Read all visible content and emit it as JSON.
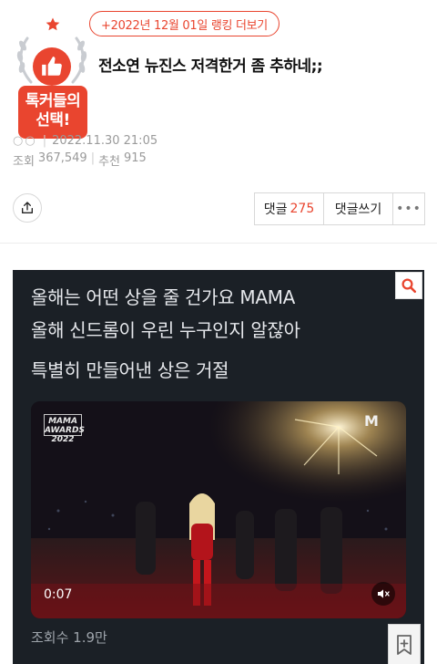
{
  "header": {
    "badge_text": "톡커들의 선택!",
    "badge_icon": "thumbs-up-icon",
    "ranking_link": "+2022년 12월 01일 랭킹 더보기",
    "title": "전소연 뉴진스 저격한거 좀 추하네;;"
  },
  "meta": {
    "author_dots": "○○",
    "datetime": "2022.11.30 21:05",
    "views_label": "조회",
    "views_value": "367,549",
    "likes_label": "추천",
    "likes_value": "915"
  },
  "actions": {
    "share_icon": "share-icon",
    "comment_label": "댓글",
    "comment_count": "275",
    "write_label": "댓글쓰기",
    "more_label": "•••"
  },
  "content": {
    "lyric_line_1": "올해는 어떤 상을 줄 건가요 MAMA",
    "lyric_line_2": "올해 신드롬이 우린 누구인지 알잖아",
    "lyric_line_3": "특별히 만들어낸 상은 거절",
    "video": {
      "logo_text": "MAMA AWARDS 2022",
      "brand_text": "M",
      "time": "0:07"
    },
    "views_text": "조회수 1.9만",
    "colors": {
      "accent": "#e9452f",
      "dark_bg": "#1b2026"
    }
  }
}
